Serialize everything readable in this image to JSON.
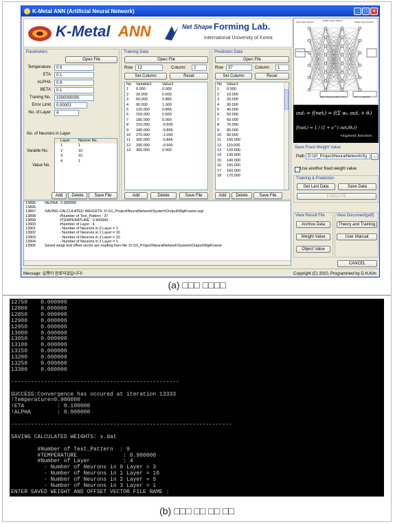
{
  "window": {
    "title": "K-Metal ANN (Artificial Neural Network)",
    "logo_text_1": "K-Metal",
    "logo_text_2": "ANN",
    "lab_text_1": "Net Shape",
    "lab_text_2": "Forming Lab.",
    "lab_text_3": "International University of Korea"
  },
  "parameters": {
    "header": "Parameters",
    "open_file": "Open File",
    "fields": [
      {
        "label": "Temperature",
        "value": "0.9"
      },
      {
        "label": "ETA",
        "value": "0.1"
      },
      {
        "label": "ALPHA",
        "value": "0.9"
      },
      {
        "label": "BETA",
        "value": "0.1"
      },
      {
        "label": "Traning No.",
        "value": "1000000000"
      },
      {
        "label": "Error Limit",
        "value": "0.00002"
      },
      {
        "label": "No. of Layer",
        "value": "4"
      }
    ],
    "neurons_label": "No. of Neurons in Layer",
    "variable_no": "Varable No.",
    "value_no": "Value No.",
    "layer_header": [
      "Layer",
      "Neuron No."
    ],
    "layer_rows": [
      [
        "1",
        "1"
      ],
      [
        "2",
        "10"
      ],
      [
        "3",
        "10"
      ],
      [
        "4",
        "1"
      ]
    ],
    "add": "Add",
    "delete": "Delete",
    "save": "Save File"
  },
  "training": {
    "header": "Training Data",
    "open_file": "Open File",
    "row_label": "Row",
    "row_value": "13",
    "col_label": "Column",
    "col_value": "2",
    "set_column": "Set Column",
    "reset": "Reset",
    "columns": [
      "No",
      "Variable1",
      "Value1"
    ],
    "rows": [
      [
        "1",
        "0.000",
        "0.000"
      ],
      [
        "2",
        "30.000",
        "0.500"
      ],
      [
        "3",
        "60.000",
        "0.866"
      ],
      [
        "4",
        "90.000",
        "1.000"
      ],
      [
        "5",
        "120.000",
        "0.866"
      ],
      [
        "6",
        "150.000",
        "0.500"
      ],
      [
        "7",
        "180.000",
        "0.000"
      ],
      [
        "8",
        "210.000",
        "-0.500"
      ],
      [
        "9",
        "240.000",
        "-0.866"
      ],
      [
        "10",
        "270.000",
        "-1.000"
      ],
      [
        "11",
        "300.000",
        "-0.866"
      ],
      [
        "12",
        "330.000",
        "-0.500"
      ],
      [
        "13",
        "360.000",
        "0.000"
      ]
    ],
    "add": "Add",
    "delete": "Delete",
    "save": "Save File"
  },
  "prediction": {
    "header": "Prediction Data",
    "open_file": "Open File",
    "row_label": "Row",
    "row_value": "37",
    "col_label": "Column",
    "col_value": "1",
    "set_column": "Set Column",
    "reset": "Reset",
    "columns": [
      "No",
      "Value1"
    ],
    "rows": [
      [
        "1",
        "0.000"
      ],
      [
        "2",
        "10.000"
      ],
      [
        "3",
        "20.000"
      ],
      [
        "4",
        "30.000"
      ],
      [
        "5",
        "40.000"
      ],
      [
        "6",
        "50.000"
      ],
      [
        "7",
        "60.000"
      ],
      [
        "8",
        "70.000"
      ],
      [
        "9",
        "80.000"
      ],
      [
        "10",
        "90.000"
      ],
      [
        "11",
        "100.000"
      ],
      [
        "12",
        "110.000"
      ],
      [
        "13",
        "120.000"
      ],
      [
        "14",
        "130.000"
      ],
      [
        "15",
        "140.000"
      ],
      [
        "16",
        "150.000"
      ],
      [
        "17",
        "160.000"
      ],
      [
        "18",
        "170.000"
      ]
    ],
    "add": "Add",
    "delete": "Delete",
    "save": "Save File"
  },
  "formula": {
    "line1": "outᵢ = f(netᵢ) = f(Σ wᵢⱼ outⱼ + θᵢ)",
    "line2": "f(netᵢ) = 1 / (1 + e^(-netᵢ/θ₀))",
    "line3": "•Sigmoid function"
  },
  "diagram_labels": {
    "input": "Input Layer Neuron",
    "hidden": "Hidden Layer Neuron",
    "output": "Output Layer Neuron",
    "training": "Training Data",
    "data": "Data",
    "adjust": "Adjust Weight & Offset Value",
    "classifier": "Error to Classifier",
    "weight": "Weight"
  },
  "save_fixed": {
    "header": "Save Fixed Weight Value",
    "path_label": "Path",
    "path_value": "D:\\10_Project\\NeuralNetwork\\Sy",
    "browse": "...",
    "checkbox_label": "Use another fixed weight value"
  },
  "train_predict": {
    "header": "Training & Prediction",
    "get_last": "Get Last Data",
    "save_data": "Save Data",
    "execute": "EXECUTE"
  },
  "view_result": {
    "header": "View Result File",
    "archive": "Archive Data",
    "weight": "Weight Value",
    "object": "Object Value"
  },
  "view_doc": {
    "header": "View Document(pdf)",
    "theory": "Theory and Training",
    "manual": "User Manual"
  },
  "cancel": "CANCEL",
  "log": [
    {
      "no": "13895",
      "text": "!ALPHA        : 0.900000",
      "ind": false
    },
    {
      "no": "13896",
      "text": "",
      "ind": false
    },
    {
      "no": "13897",
      "text": "SAVING CALCULATED WEIGHTS: D:\\10_Project\\NeuralNetwork\\System\\Output\\WgtFname.wgt",
      "ind": false
    },
    {
      "no": "13898",
      "text": "#Number of Test_Pattern  : 37",
      "ind": true
    },
    {
      "no": "13899",
      "text": "#TEMPERATURE              : 0.900000",
      "ind": true
    },
    {
      "no": "13900",
      "text": "#Number of Layer          : 4",
      "ind": true
    },
    {
      "no": "13901",
      "text": "- Number of Neurons in 0 Layer = 1",
      "ind": true
    },
    {
      "no": "13902",
      "text": "- Number of Neurons in 1 Layer = 10",
      "ind": true
    },
    {
      "no": "13903",
      "text": "- Number of Neurons in 2 Layer = 10",
      "ind": true
    },
    {
      "no": "13904",
      "text": "- Number of Neurons in 3 Layer = 1",
      "ind": true
    },
    {
      "no": "13905",
      "text": "Saved weigt and offset vector are reading from file :D:\\10_Project\\NeuralNetwork\\System\\Output\\WgtFname",
      "ind": false
    }
  ],
  "status_message": "Message: 실행이 완료되었습니다!",
  "copyright": "Copyright (C) 2010,  Programmed by D.H.Kim",
  "caption_a": "(a)  □□□  □□□□",
  "caption_b": "(b)  □□□  □□  □□  □□",
  "console": [
    "12750    0.000000",
    "12800    0.000000",
    "12850    0.000000",
    "12900    0.000000",
    "12950    0.000000",
    "13000    0.000000",
    "13050    0.000000",
    "13100    0.000000",
    "13150    0.000000",
    "13200    0.000000",
    "13250    0.000000",
    "13300    0.000000",
    "",
    "---------------------------------------------------",
    "",
    "SUCCESS:Convergence has occured at iteration 13333",
    "!Temperature=0.900000",
    "!ETA          : 0.100000",
    "!ALPHA        : 0.900000",
    "",
    "-------------------------------------------------------------------",
    "",
    "SAVING CALCULATED WEIGHTS: s.dat",
    "",
    "        #Number of Test_Pattern  : 9",
    "        #TEMPERATURE              : 0.900000",
    "        #Number of Layer          : 4",
    "          - Number of Neurons in 0 Layer = 3",
    "          - Number of Neurons in 1 Layer = 10",
    "          - Number of Neurons in 2 Layer = 5",
    "          - Number of Neurons in 3 Layer = 1",
    "ENTER SAVED WEIGHT AND OFFSET VECTOR FILE NAME :"
  ]
}
